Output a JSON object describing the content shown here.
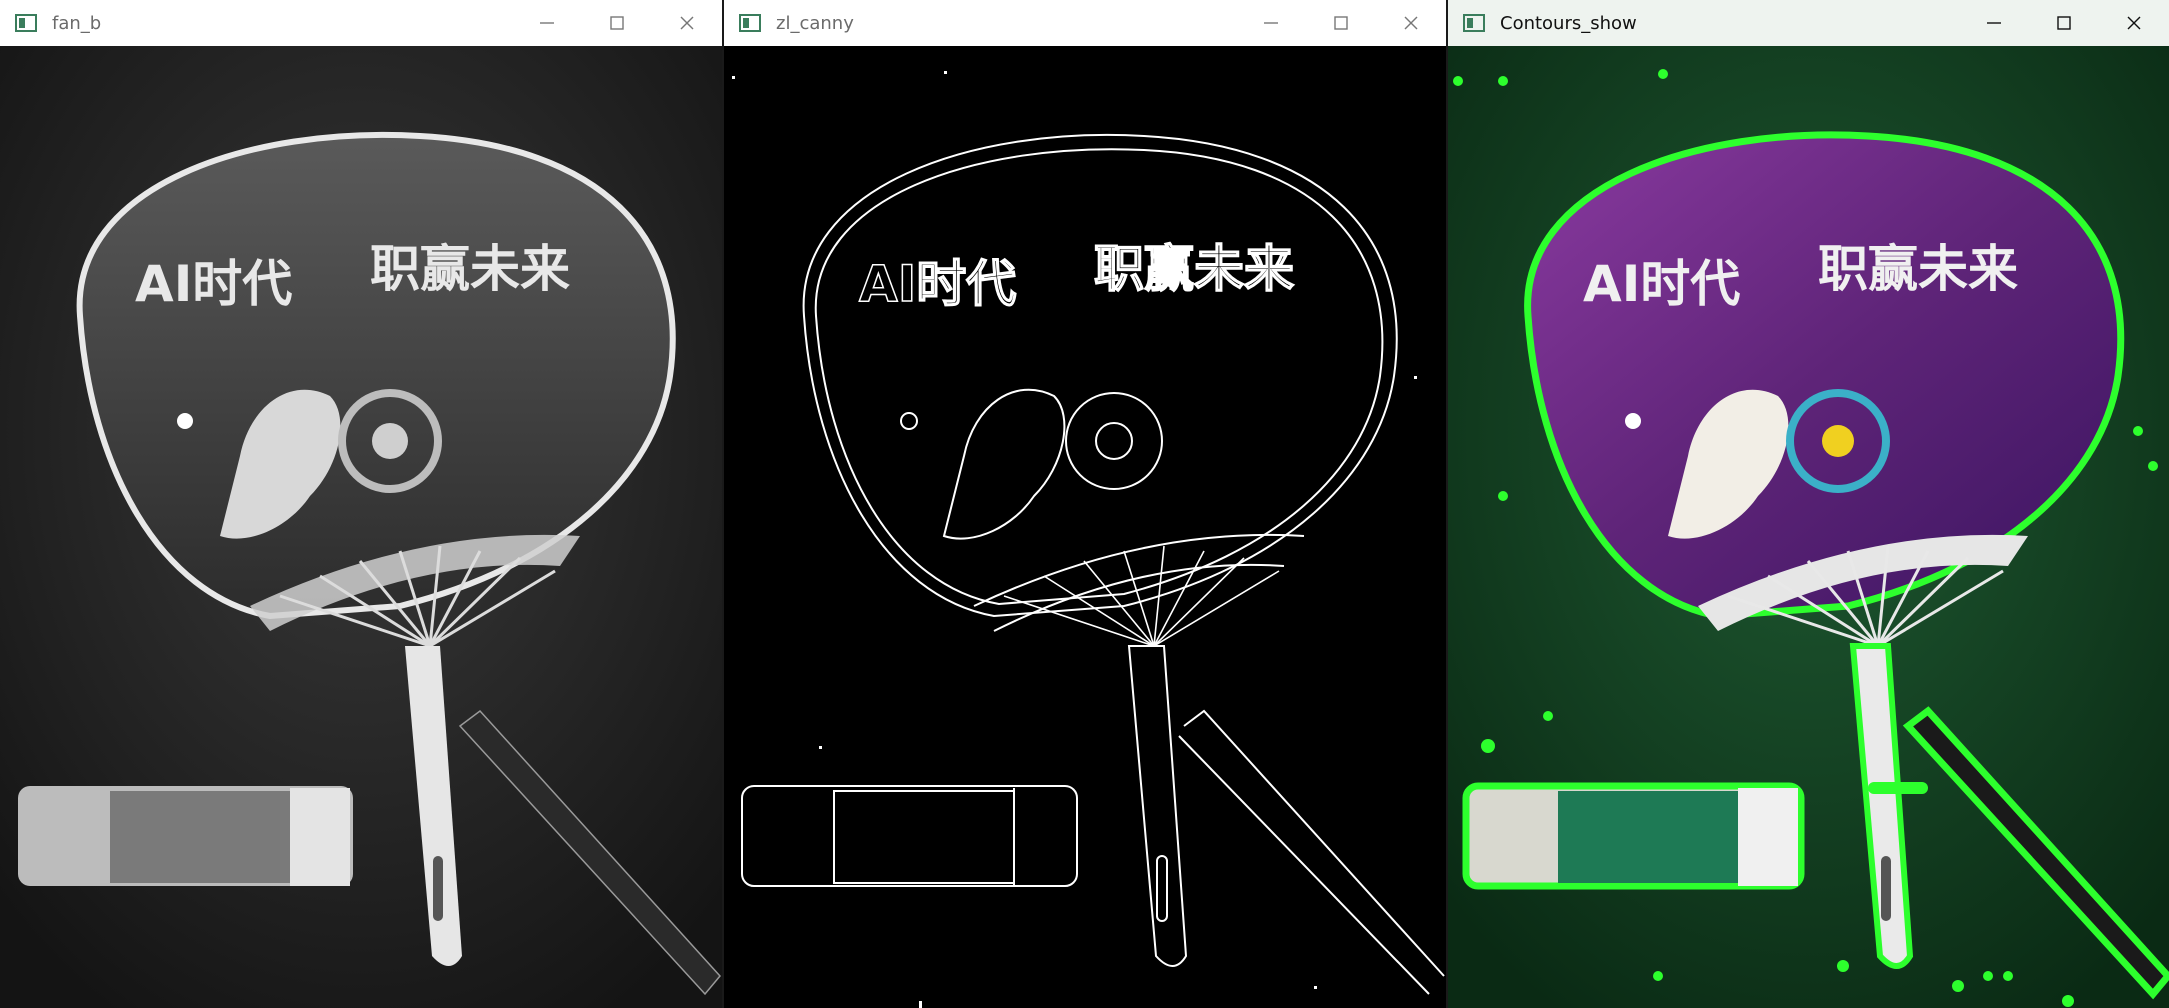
{
  "windows": [
    {
      "title": "fan_b",
      "image_name": "grayscale photo of hand fan, glue stick and pen"
    },
    {
      "title": "zl_canny",
      "image_name": "canny edge detection output"
    },
    {
      "title": "Contours_show",
      "image_name": "color photo with green contours drawn"
    }
  ],
  "fan_text": {
    "left": "AI时代",
    "right": "职赢未来"
  },
  "icons": [
    "app-icon",
    "minimize-icon",
    "maximize-icon",
    "close-icon"
  ],
  "colors": {
    "contour": "#2dff2d",
    "fan_purple": "#6a2a8a",
    "bg_green": "#0f3a1e",
    "bg_gray": "#222222"
  }
}
